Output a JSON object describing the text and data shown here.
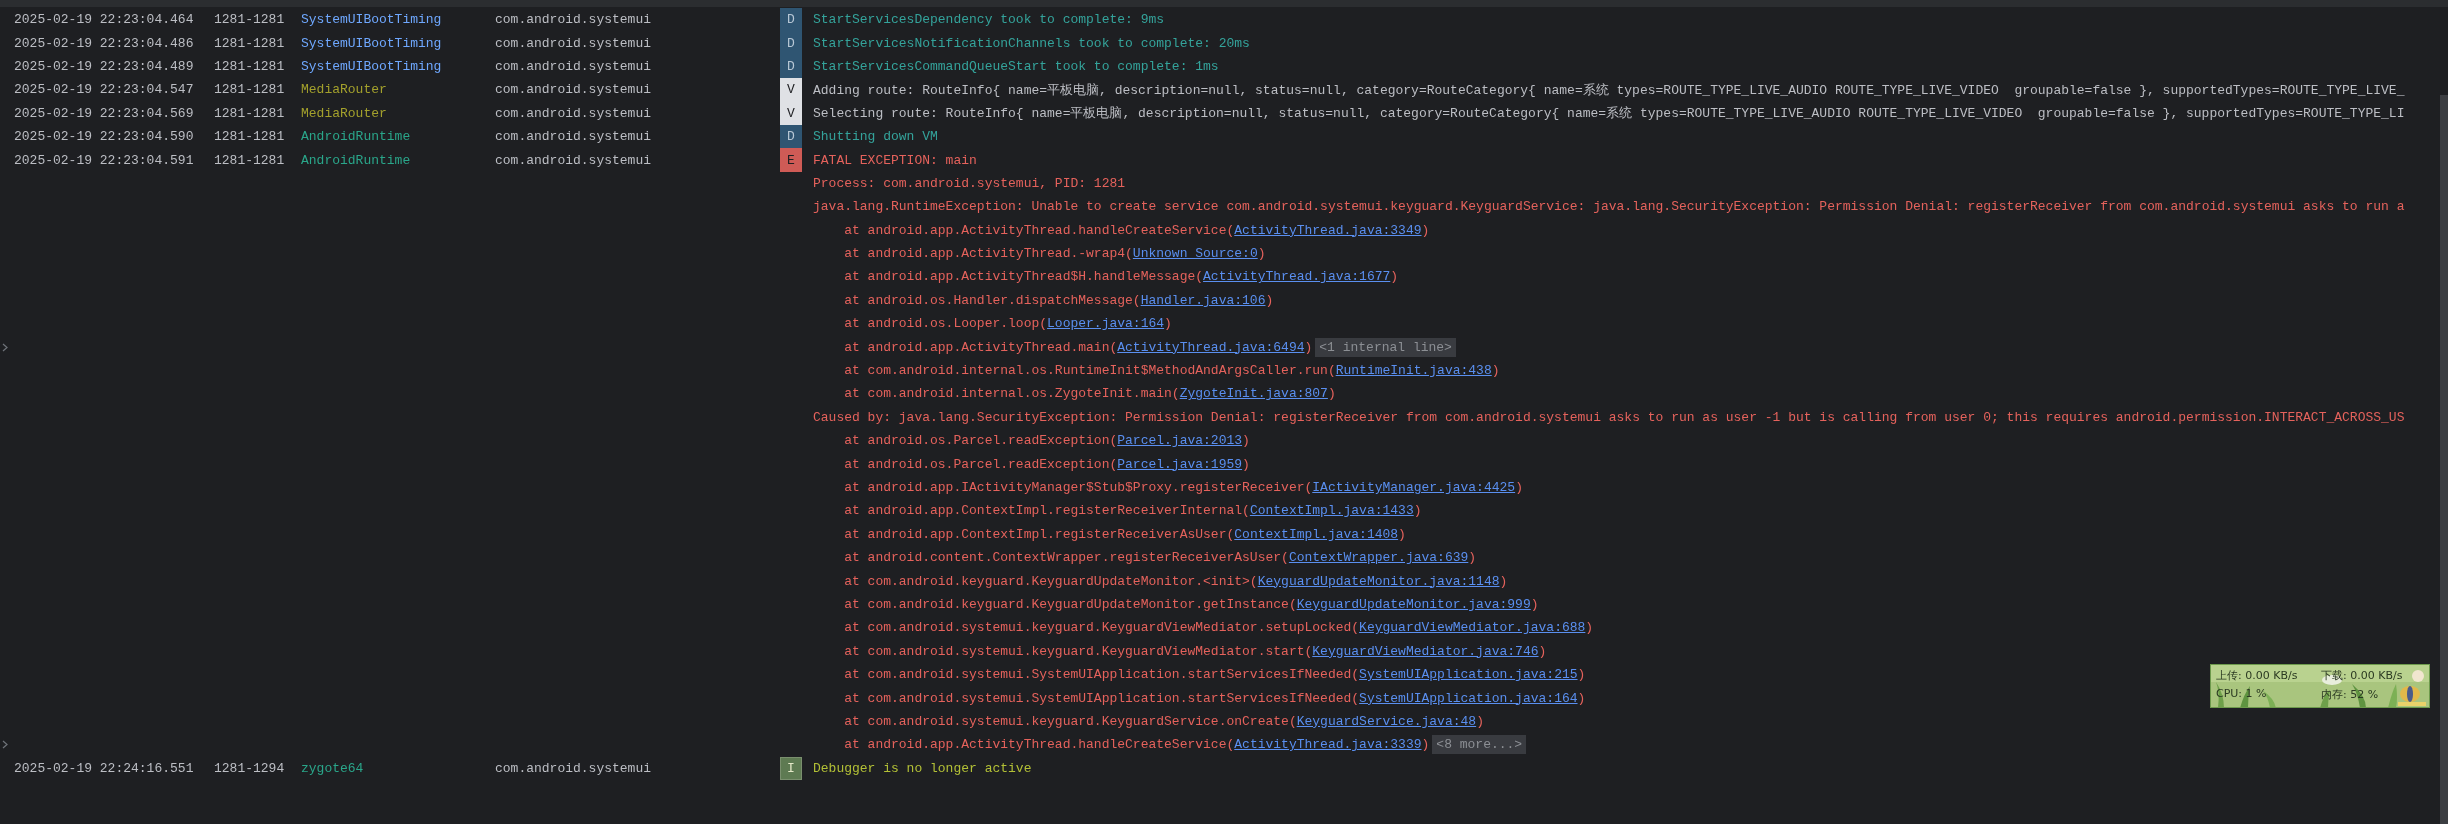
{
  "entries": [
    {
      "date": "2025-02-19 22:23:04.464",
      "pid": "1281-1281",
      "tag": "SystemUIBootTiming",
      "color": "#6fa8ff",
      "package": "com.android.systemui",
      "kind": "debug",
      "level": "D",
      "message": "StartServicesDependency took to complete: 9ms"
    },
    {
      "date": "2025-02-19 22:23:04.486",
      "pid": "1281-1281",
      "tag": "SystemUIBootTiming",
      "color": "#6fa8ff",
      "package": "com.android.systemui",
      "kind": "debug",
      "level": "D",
      "message": "StartServicesNotificationChannels took to complete: 20ms"
    },
    {
      "date": "2025-02-19 22:23:04.489",
      "pid": "1281-1281",
      "tag": "SystemUIBootTiming",
      "color": "#6fa8ff",
      "package": "com.android.systemui",
      "kind": "debug",
      "level": "D",
      "message": "StartServicesCommandQueueStart took to complete: 1ms"
    },
    {
      "date": "2025-02-19 22:23:04.547",
      "pid": "1281-1281",
      "tag": "MediaRouter",
      "color": "#a3a02c",
      "package": "com.android.systemui",
      "kind": "verbose",
      "level": "V",
      "message": "Adding route: RouteInfo{ name=平板电脑, description=null, status=null, category=RouteCategory{ name=系统 types=ROUTE_TYPE_LIVE_AUDIO ROUTE_TYPE_LIVE_VIDEO  groupable=false }, supportedTypes=ROUTE_TYPE_LIVE_"
    },
    {
      "date": "2025-02-19 22:23:04.569",
      "pid": "1281-1281",
      "tag": "MediaRouter",
      "color": "#a3a02c",
      "package": "com.android.systemui",
      "kind": "verbose",
      "level": "V",
      "message": "Selecting route: RouteInfo{ name=平板电脑, description=null, status=null, category=RouteCategory{ name=系统 types=ROUTE_TYPE_LIVE_AUDIO ROUTE_TYPE_LIVE_VIDEO  groupable=false }, supportedTypes=ROUTE_TYPE_LI"
    },
    {
      "date": "2025-02-19 22:23:04.590",
      "pid": "1281-1281",
      "tag": "AndroidRuntime",
      "color": "#2aa68a",
      "package": "com.android.systemui",
      "kind": "debug",
      "level": "D",
      "message": "Shutting down VM"
    },
    {
      "date": "2025-02-19 22:23:04.591",
      "pid": "1281-1281",
      "tag": "AndroidRuntime",
      "color": "#2aa68a",
      "package": "com.android.systemui",
      "kind": "error",
      "level": "E",
      "message": "FATAL EXCEPTION: main",
      "trace": [
        {
          "kind": "text",
          "text": "Process: com.android.systemui, PID: 1281"
        },
        {
          "kind": "text",
          "text": "java.lang.RuntimeException: Unable to create service com.android.systemui.keyguard.KeyguardService: java.lang.SecurityException: Permission Denial: registerReceiver from com.android.systemui asks to run a"
        },
        {
          "kind": "frame",
          "call": "at android.app.ActivityThread.handleCreateService(",
          "link": "ActivityThread.java:3349",
          "after": ")"
        },
        {
          "kind": "frame",
          "call": "at android.app.ActivityThread.-wrap4(",
          "link": "Unknown Source:0",
          "after": ")"
        },
        {
          "kind": "frame",
          "call": "at android.app.ActivityThread$H.handleMessage(",
          "link": "ActivityThread.java:1677",
          "after": ")"
        },
        {
          "kind": "frame",
          "call": "at android.os.Handler.dispatchMessage(",
          "link": "Handler.java:106",
          "after": ")"
        },
        {
          "kind": "frame",
          "call": "at android.os.Looper.loop(",
          "link": "Looper.java:164",
          "after": ")"
        },
        {
          "kind": "frame",
          "call": "at android.app.ActivityThread.main(",
          "link": "ActivityThread.java:6494",
          "after": ")",
          "folded": "<1 internal line>"
        },
        {
          "kind": "frame",
          "call": "at com.android.internal.os.RuntimeInit$MethodAndArgsCaller.run(",
          "link": "RuntimeInit.java:438",
          "after": ")"
        },
        {
          "kind": "frame",
          "call": "at com.android.internal.os.ZygoteInit.main(",
          "link": "ZygoteInit.java:807",
          "after": ")"
        },
        {
          "kind": "text",
          "text": "Caused by: java.lang.SecurityException: Permission Denial: registerReceiver from com.android.systemui asks to run as user -1 but is calling from user 0; this requires android.permission.INTERACT_ACROSS_US"
        },
        {
          "kind": "frame",
          "call": "at android.os.Parcel.readException(",
          "link": "Parcel.java:2013",
          "after": ")"
        },
        {
          "kind": "frame",
          "call": "at android.os.Parcel.readException(",
          "link": "Parcel.java:1959",
          "after": ")"
        },
        {
          "kind": "frame",
          "call": "at android.app.IActivityManager$Stub$Proxy.registerReceiver(",
          "link": "IActivityManager.java:4425",
          "after": ")"
        },
        {
          "kind": "frame",
          "call": "at android.app.ContextImpl.registerReceiverInternal(",
          "link": "ContextImpl.java:1433",
          "after": ")"
        },
        {
          "kind": "frame",
          "call": "at android.app.ContextImpl.registerReceiverAsUser(",
          "link": "ContextImpl.java:1408",
          "after": ")"
        },
        {
          "kind": "frame",
          "call": "at android.content.ContextWrapper.registerReceiverAsUser(",
          "link": "ContextWrapper.java:639",
          "after": ")"
        },
        {
          "kind": "frame",
          "call": "at com.android.keyguard.KeyguardUpdateMonitor.<init>(",
          "link": "KeyguardUpdateMonitor.java:1148",
          "after": ")"
        },
        {
          "kind": "frame",
          "call": "at com.android.keyguard.KeyguardUpdateMonitor.getInstance(",
          "link": "KeyguardUpdateMonitor.java:999",
          "after": ")"
        },
        {
          "kind": "frame",
          "call": "at com.android.systemui.keyguard.KeyguardViewMediator.setupLocked(",
          "link": "KeyguardViewMediator.java:688",
          "after": ")"
        },
        {
          "kind": "frame",
          "call": "at com.android.systemui.keyguard.KeyguardViewMediator.start(",
          "link": "KeyguardViewMediator.java:746",
          "after": ")"
        },
        {
          "kind": "frame",
          "call": "at com.android.systemui.SystemUIApplication.startServicesIfNeeded(",
          "link": "SystemUIApplication.java:215",
          "after": ")"
        },
        {
          "kind": "frame",
          "call": "at com.android.systemui.SystemUIApplication.startServicesIfNeeded(",
          "link": "SystemUIApplication.java:164",
          "after": ")"
        },
        {
          "kind": "frame",
          "call": "at com.android.systemui.keyguard.KeyguardService.onCreate(",
          "link": "KeyguardService.java:48",
          "after": ")"
        },
        {
          "kind": "frame",
          "call": "at android.app.ActivityThread.handleCreateService(",
          "link": "ActivityThread.java:3339",
          "after": ")",
          "folded": "<8 more...>"
        }
      ]
    },
    {
      "date": "2025-02-19 22:24:16.551",
      "pid": "1281-1294",
      "tag": "zygote64",
      "color": "#2aa68a",
      "package": "com.android.systemui",
      "kind": "info",
      "level": "I",
      "message": "Debugger is no longer active"
    }
  ],
  "monitor": {
    "upload": "上传: 0.00 KB/s",
    "download": "下载: 0.00 KB/s",
    "cpu": "CPU: 1 %",
    "memory": "内存: 52 %"
  }
}
